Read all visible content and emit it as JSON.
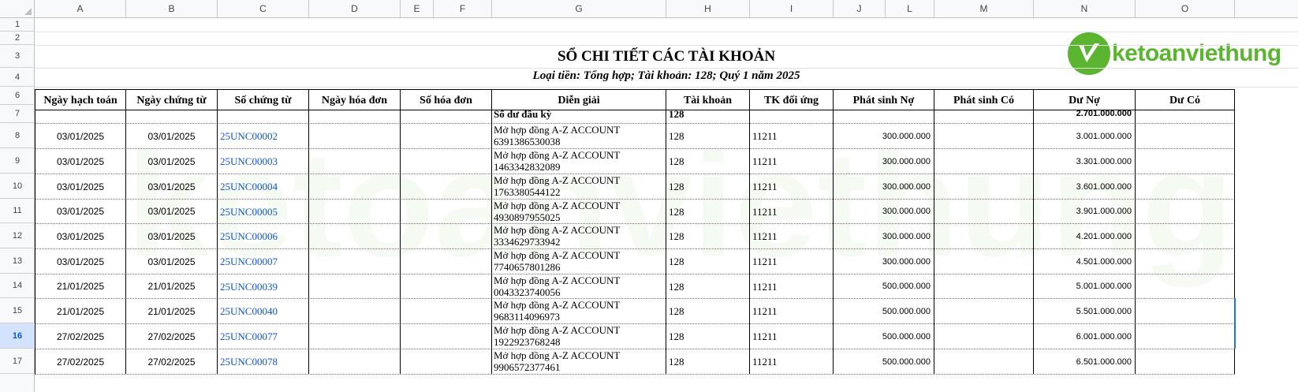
{
  "columns": [
    "A",
    "B",
    "C",
    "D",
    "E",
    "F",
    "G",
    "H",
    "I",
    "J",
    "L",
    "M",
    "N",
    "O"
  ],
  "rows": [
    "1",
    "2",
    "3",
    "4",
    "6",
    "7",
    "8",
    "9",
    "10",
    "11",
    "12",
    "13",
    "14",
    "15",
    "16",
    "17"
  ],
  "selected_row": "16",
  "report": {
    "title": "SỔ CHI TIẾT CÁC TÀI KHOẢN",
    "subtitle": "Loại tiền: Tổng hợp; Tài khoản: 128; Quý 1 năm 2025"
  },
  "logo": {
    "text": "ketoanviethung",
    "brand_color": "#5cb531"
  },
  "headers": [
    "Ngày hạch toán",
    "Ngày chứng từ",
    "Số chứng từ",
    "Ngày hóa đơn",
    "Số hóa đơn",
    "Diễn giải",
    "Tài khoản",
    "TK đối ứng",
    "Phát sinh Nợ",
    "Phát sinh Có",
    "Dư Nợ",
    "Dư Có"
  ],
  "opening": {
    "label": "Số dư đầu kỳ",
    "account": "128",
    "balance_debit": "2.701.000.000"
  },
  "entries": [
    {
      "posting_date": "03/01/2025",
      "voucher_date": "03/01/2025",
      "voucher_no": "25UNC00002",
      "desc1": "Mở hợp đồng A-Z ACCOUNT",
      "desc2": "6391386530038",
      "account": "128",
      "contra": "11211",
      "debit": "300.000.000",
      "balance": "3.001.000.000"
    },
    {
      "posting_date": "03/01/2025",
      "voucher_date": "03/01/2025",
      "voucher_no": "25UNC00003",
      "desc1": "Mở hợp đồng A-Z ACCOUNT",
      "desc2": "1463342832089",
      "account": "128",
      "contra": "11211",
      "debit": "300.000.000",
      "balance": "3.301.000.000"
    },
    {
      "posting_date": "03/01/2025",
      "voucher_date": "03/01/2025",
      "voucher_no": "25UNC00004",
      "desc1": "Mở hợp đồng A-Z ACCOUNT",
      "desc2": "1763380544122",
      "account": "128",
      "contra": "11211",
      "debit": "300.000.000",
      "balance": "3.601.000.000"
    },
    {
      "posting_date": "03/01/2025",
      "voucher_date": "03/01/2025",
      "voucher_no": "25UNC00005",
      "desc1": "Mở hợp đồng A-Z ACCOUNT",
      "desc2": "4930897955025",
      "account": "128",
      "contra": "11211",
      "debit": "300.000.000",
      "balance": "3.901.000.000"
    },
    {
      "posting_date": "03/01/2025",
      "voucher_date": "03/01/2025",
      "voucher_no": "25UNC00006",
      "desc1": "Mở hợp đồng A-Z ACCOUNT",
      "desc2": "3334629733942",
      "account": "128",
      "contra": "11211",
      "debit": "300.000.000",
      "balance": "4.201.000.000"
    },
    {
      "posting_date": "03/01/2025",
      "voucher_date": "03/01/2025",
      "voucher_no": "25UNC00007",
      "desc1": "Mở hợp đồng A-Z ACCOUNT",
      "desc2": "7740657801286",
      "account": "128",
      "contra": "11211",
      "debit": "300.000.000",
      "balance": "4.501.000.000"
    },
    {
      "posting_date": "21/01/2025",
      "voucher_date": "21/01/2025",
      "voucher_no": "25UNC00039",
      "desc1": "Mở hợp đồng A-Z ACCOUNT",
      "desc2": "0043323740056",
      "account": "128",
      "contra": "11211",
      "debit": "500.000.000",
      "balance": "5.001.000.000"
    },
    {
      "posting_date": "21/01/2025",
      "voucher_date": "21/01/2025",
      "voucher_no": "25UNC00040",
      "desc1": "Mở hợp đồng A-Z ACCOUNT",
      "desc2": "9683114096973",
      "account": "128",
      "contra": "11211",
      "debit": "500.000.000",
      "balance": "5.501.000.000"
    },
    {
      "posting_date": "27/02/2025",
      "voucher_date": "27/02/2025",
      "voucher_no": "25UNC00077",
      "desc1": "Mở hợp đồng A-Z ACCOUNT",
      "desc2": "1922923768248",
      "account": "128",
      "contra": "11211",
      "debit": "500.000.000",
      "balance": "6.001.000.000"
    },
    {
      "posting_date": "27/02/2025",
      "voucher_date": "27/02/2025",
      "voucher_no": "25UNC00078",
      "desc1": "Mở hợp đồng A-Z ACCOUNT",
      "desc2": "9906572377461",
      "account": "128",
      "contra": "11211",
      "debit": "500.000.000",
      "balance": "6.501.000.000"
    }
  ]
}
